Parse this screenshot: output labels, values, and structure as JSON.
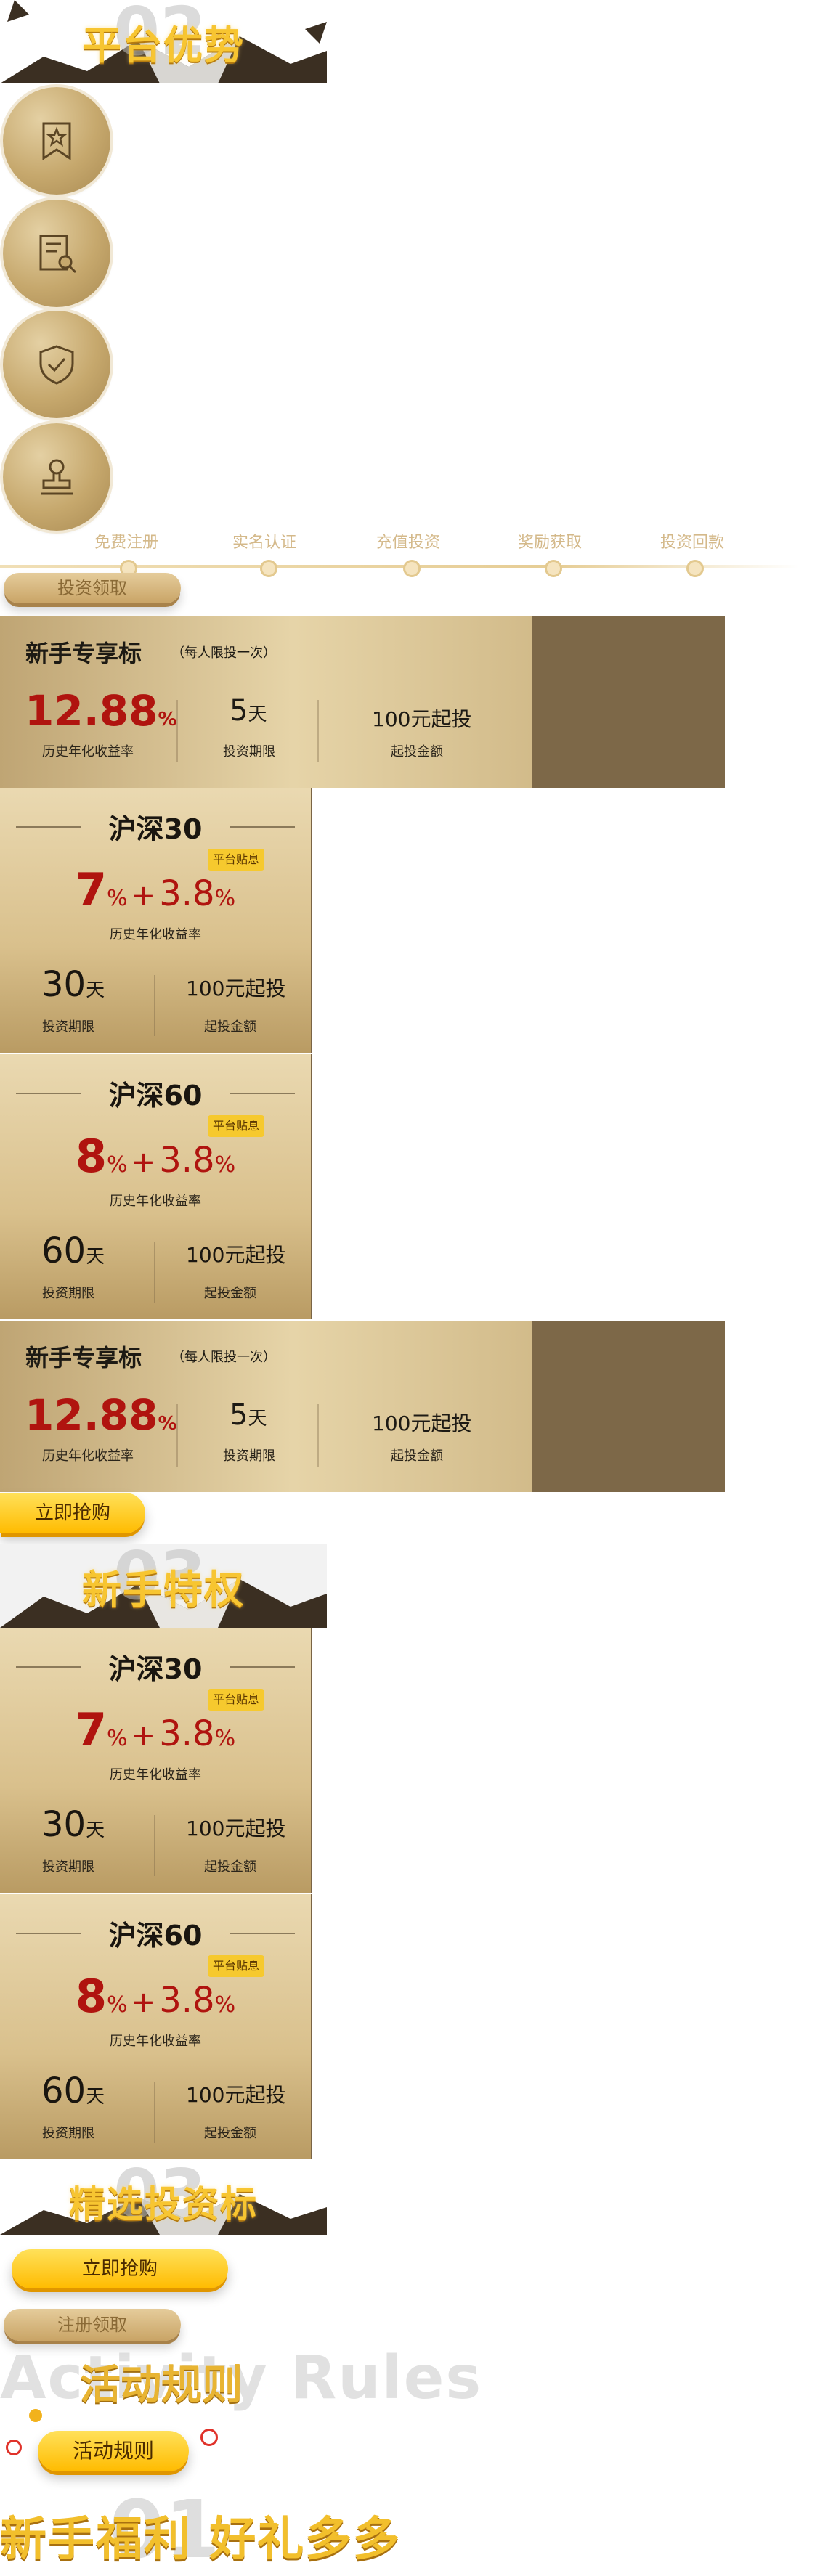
{
  "sections": {
    "advantage": {
      "num": "02",
      "title": "平台优势"
    },
    "newbie": {
      "num": "03",
      "title": "新手特权"
    },
    "selected": {
      "num": "03",
      "title": "精选投资标"
    },
    "welfare": {
      "num": "01",
      "title": "新手福利 好礼多多"
    }
  },
  "icons": [
    "bookmark-star-icon",
    "document-search-icon",
    "shield-check-icon",
    "stamp-icon"
  ],
  "steps": [
    "免费注册",
    "实名认证",
    "充值投资",
    "奖励获取",
    "投资回款"
  ],
  "buttons": {
    "invest_receive": "投资领取",
    "buy_now_1": "立即抢购",
    "buy_now_2": "立即抢购",
    "register_receive": "注册领取",
    "activity_rules": "活动规则"
  },
  "newbie_card": {
    "title": "新手专享标",
    "subtitle": "（每人限投一次）",
    "rate": "12.88",
    "rate_unit": "%",
    "rate_label": "历史年化收益率",
    "term_value": "5",
    "term_unit": "天",
    "term_label": "投资期限",
    "min": "100元起投",
    "min_label": "起投金额"
  },
  "products": [
    {
      "title": "沪深30",
      "badge": "平台贴息",
      "base": "7",
      "pct": "%",
      "plus": "+",
      "bonus": "3.8",
      "pct2": "%",
      "rate_label": "历史年化收益率",
      "term_value": "30",
      "term_unit": "天",
      "term_label": "投资期限",
      "min": "100元起投",
      "min_label": "起投金额"
    },
    {
      "title": "沪深60",
      "badge": "平台贴息",
      "base": "8",
      "pct": "%",
      "plus": "+",
      "bonus": "3.8",
      "pct2": "%",
      "rate_label": "历史年化收益率",
      "term_value": "60",
      "term_unit": "天",
      "term_label": "投资期限",
      "min": "100元起投",
      "min_label": "起投金额"
    }
  ],
  "rules": {
    "en": "Activity Rules",
    "cn": "活动规则"
  },
  "colors": {
    "gold": "#f7c531",
    "tan": "#c9a466",
    "rate_red": "#b0140f",
    "card_dark": "#7d6848"
  }
}
